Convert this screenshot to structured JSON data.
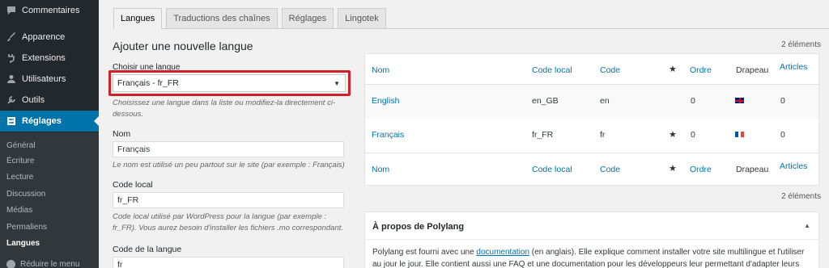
{
  "sidebar": {
    "items": [
      {
        "label": "Commentaires",
        "icon": "comment-icon"
      },
      {
        "label": "Apparence",
        "icon": "brush-icon"
      },
      {
        "label": "Extensions",
        "icon": "plugin-icon"
      },
      {
        "label": "Utilisateurs",
        "icon": "user-icon"
      },
      {
        "label": "Outils",
        "icon": "wrench-icon"
      },
      {
        "label": "Réglages",
        "icon": "settings-icon"
      }
    ],
    "submenu": [
      "Général",
      "Écriture",
      "Lecture",
      "Discussion",
      "Médias",
      "Permaliens",
      "Langues"
    ],
    "collapse_label": "Réduire le menu"
  },
  "tabs": [
    "Langues",
    "Traductions des chaînes",
    "Réglages",
    "Lingotek"
  ],
  "form": {
    "heading": "Ajouter une nouvelle langue",
    "choose_label": "Choisir une langue",
    "choose_value": "Français - fr_FR",
    "choose_desc": "Choisissez une langue dans la liste ou modifiez-la directement ci-dessous.",
    "name_label": "Nom",
    "name_value": "Français",
    "name_desc": "Le nom est utilisé un peu partout sur le site (par exemple : Français)",
    "locale_label": "Code local",
    "locale_value": "fr_FR",
    "locale_desc": "Code local utilisé par WordPress pour la langue (par exemple : fr_FR). Vous aurez besoin d'installer les fichiers .mo correspondant.",
    "code_label": "Code de la langue",
    "code_value": "fr"
  },
  "table": {
    "count": "2 éléments",
    "headers": {
      "name": "Nom",
      "locale": "Code local",
      "code": "Code",
      "order": "Ordre",
      "flag": "Drapeau",
      "articles": "Articles"
    },
    "rows": [
      {
        "name": "English",
        "locale": "en_GB",
        "code": "en",
        "default": "",
        "order": "0",
        "flag": "flag-gb",
        "articles": "0"
      },
      {
        "name": "Français",
        "locale": "fr_FR",
        "code": "fr",
        "default": "★",
        "order": "0",
        "flag": "flag-fr",
        "articles": "0"
      }
    ],
    "star": "★"
  },
  "about": {
    "title": "À propos de Polylang",
    "toggle": "▲",
    "text_before": "Polylang est fourni avec une ",
    "link": "documentation",
    "text_after": " (en anglais). Elle explique comment installer votre site multilingue et l'utiliser au jour le jour. Elle contient aussi une FAQ et une documentation pour les développeurs leur permettant d'adapter leurs"
  },
  "colors": {
    "accent": "#0073aa",
    "highlight": "#d0202a",
    "sidebar": "#23282d"
  }
}
